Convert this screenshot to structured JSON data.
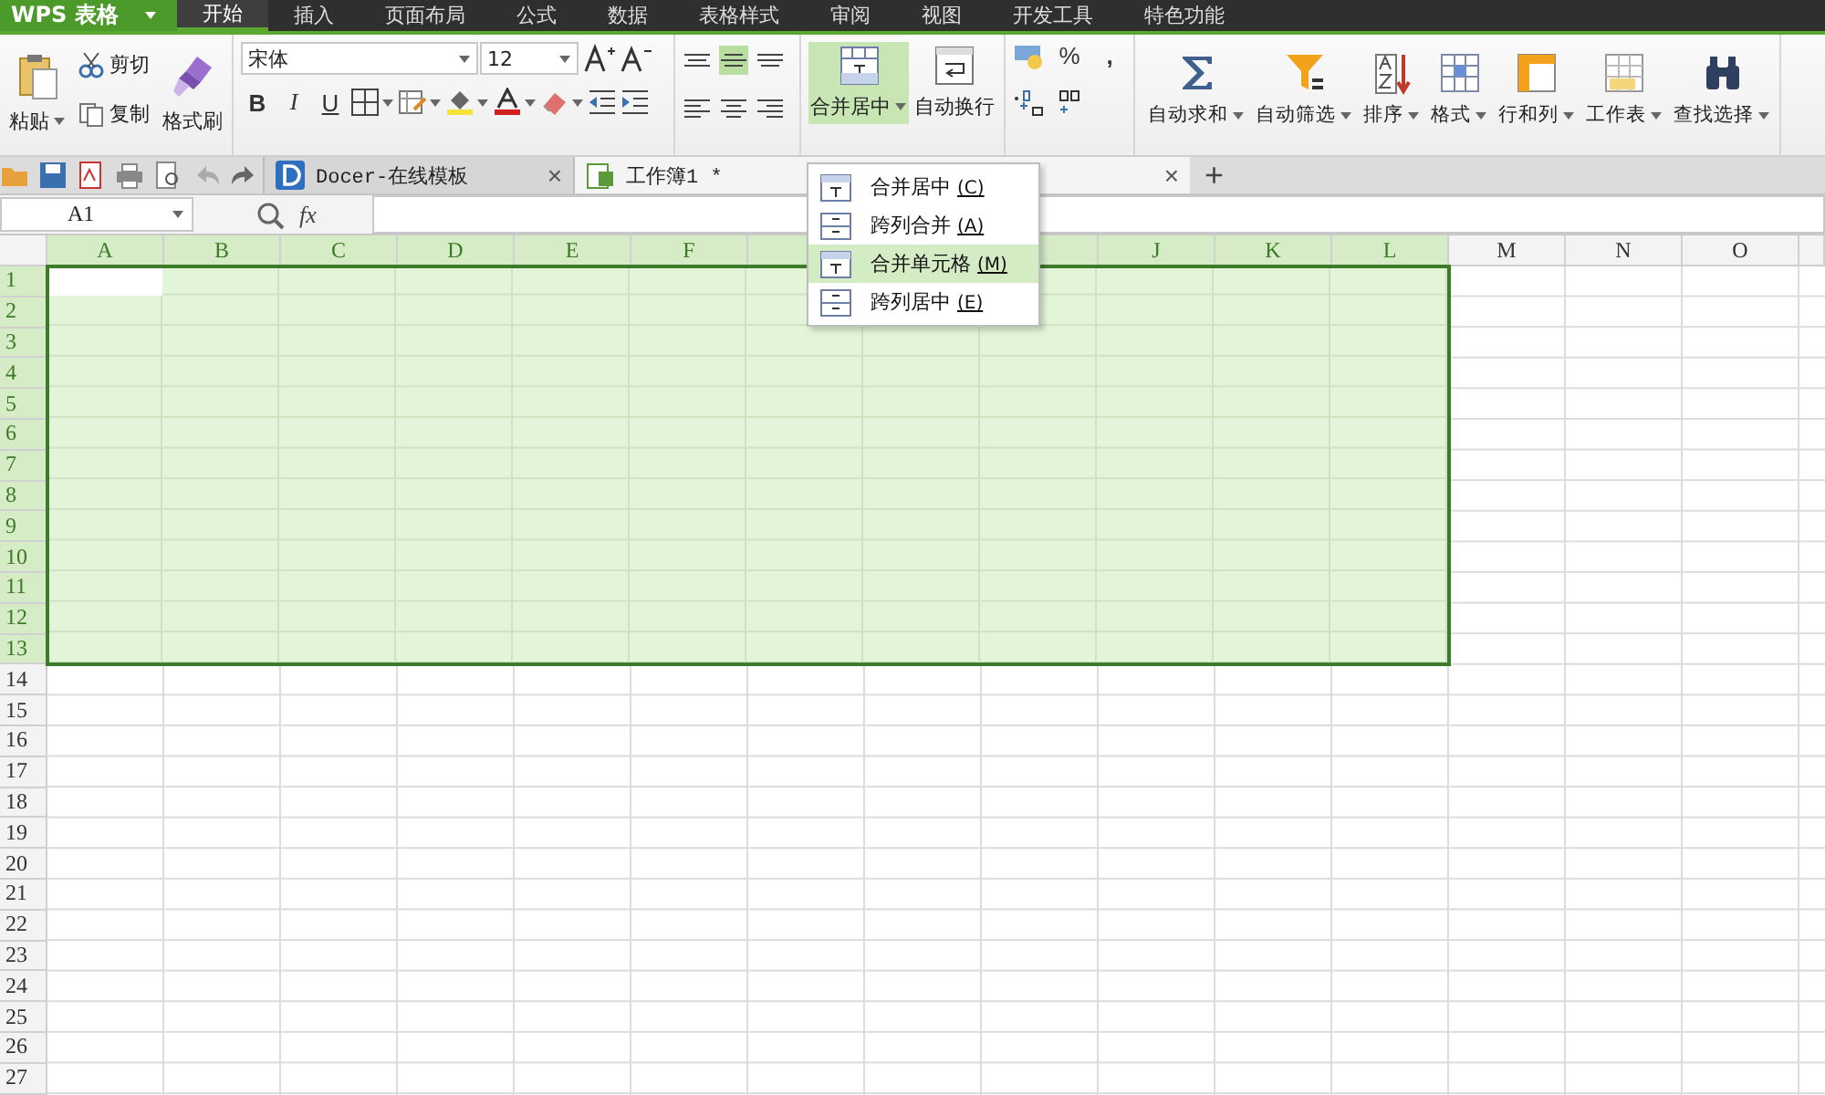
{
  "app_menu": {
    "label": "WPS 表格"
  },
  "menu_tabs": [
    {
      "label": "开始",
      "selected": true
    },
    {
      "label": "插入",
      "selected": false
    },
    {
      "label": "页面布局",
      "selected": false
    },
    {
      "label": "公式",
      "selected": false
    },
    {
      "label": "数据",
      "selected": false
    },
    {
      "label": "表格样式",
      "selected": false
    },
    {
      "label": "审阅",
      "selected": false
    },
    {
      "label": "视图",
      "selected": false
    },
    {
      "label": "开发工具",
      "selected": false
    },
    {
      "label": "特色功能",
      "selected": false
    }
  ],
  "ribbon": {
    "clipboard": {
      "paste": "粘贴",
      "cut": "剪切",
      "copy": "复制",
      "format_painter": "格式刷"
    },
    "font": {
      "name": "宋体",
      "size": "12",
      "bold": "B",
      "italic": "I",
      "underline": "U"
    },
    "vertical_align": [
      {
        "kind": "top",
        "selected": false
      },
      {
        "kind": "middle",
        "selected": true
      },
      {
        "kind": "bottom",
        "selected": false
      }
    ],
    "merge": {
      "label": "合并居中",
      "expanded": true
    },
    "wrap": {
      "label": "自动换行"
    },
    "number": {
      "percent": "%",
      "comma": ","
    },
    "tools": [
      {
        "label": "自动求和",
        "kind": "sum"
      },
      {
        "label": "自动筛选",
        "kind": "filter"
      },
      {
        "label": "排序",
        "kind": "sort"
      },
      {
        "label": "格式",
        "kind": "format"
      },
      {
        "label": "行和列",
        "kind": "rowcol"
      },
      {
        "label": "工作表",
        "kind": "sheet"
      },
      {
        "label": "查找选择",
        "kind": "find"
      }
    ]
  },
  "merge_menu": {
    "items": [
      {
        "label": "合并居中",
        "key": "(C)",
        "kind": "center",
        "selected": false
      },
      {
        "label": "跨列合并",
        "key": "(A)",
        "kind": "across",
        "selected": false
      },
      {
        "label": "合并单元格",
        "key": "(M)",
        "kind": "cells",
        "selected": true
      },
      {
        "label": "跨列居中",
        "key": "(E)",
        "kind": "across",
        "selected": false
      }
    ]
  },
  "doc_tabs": [
    {
      "label": "Docer-在线模板",
      "close": "×",
      "selected": false
    },
    {
      "label": "工作簿1 *",
      "close": "×",
      "selected": true
    }
  ],
  "new_tab": "+",
  "formula_bar": {
    "name_box": "A1",
    "fx": "fx"
  },
  "sheet": {
    "columns": [
      {
        "label": "A",
        "selected": true
      },
      {
        "label": "B",
        "selected": true
      },
      {
        "label": "C",
        "selected": true
      },
      {
        "label": "D",
        "selected": true
      },
      {
        "label": "E",
        "selected": true
      },
      {
        "label": "F",
        "selected": true
      },
      {
        "selected": true
      },
      {},
      {
        "selected": true
      },
      {
        "label": "J",
        "selected": true
      },
      {
        "label": "K",
        "selected": true
      },
      {
        "label": "L",
        "selected": true
      },
      {
        "label": "M",
        "selected": false
      },
      {
        "label": "N",
        "selected": false
      },
      {
        "label": "O",
        "selected": false
      }
    ],
    "rows": [
      {
        "label": "1",
        "selected": true
      },
      {
        "label": "2",
        "selected": true
      },
      {
        "label": "3",
        "selected": true
      },
      {
        "label": "4",
        "selected": true
      },
      {
        "label": "5",
        "selected": true
      },
      {
        "label": "6",
        "selected": true
      },
      {
        "label": "7",
        "selected": true
      },
      {
        "label": "8",
        "selected": true
      },
      {
        "label": "9",
        "selected": true
      },
      {
        "label": "10",
        "selected": true
      },
      {
        "label": "11",
        "selected": true
      },
      {
        "label": "12",
        "selected": true
      },
      {
        "label": "13",
        "selected": true
      },
      {
        "label": "14",
        "selected": false
      },
      {
        "label": "15",
        "selected": false
      },
      {
        "label": "16",
        "selected": false
      },
      {
        "label": "17",
        "selected": false
      },
      {
        "label": "18",
        "selected": false
      },
      {
        "label": "19",
        "selected": false
      },
      {
        "label": "20",
        "selected": false
      },
      {
        "label": "21",
        "selected": false
      },
      {
        "label": "22",
        "selected": false
      },
      {
        "label": "23",
        "selected": false
      },
      {
        "label": "24",
        "selected": false
      },
      {
        "label": "25",
        "selected": false
      },
      {
        "label": "26",
        "selected": false
      },
      {
        "label": "27",
        "selected": false
      }
    ]
  }
}
